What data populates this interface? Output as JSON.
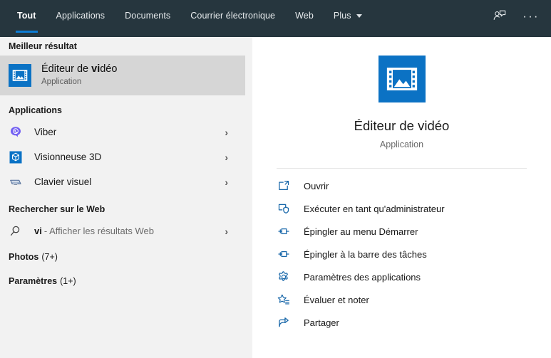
{
  "header": {
    "tabs": [
      {
        "label": "Tout",
        "active": true
      },
      {
        "label": "Applications",
        "active": false
      },
      {
        "label": "Documents",
        "active": false
      },
      {
        "label": "Courrier électronique",
        "active": false
      },
      {
        "label": "Web",
        "active": false
      },
      {
        "label": "Plus",
        "active": false,
        "has_caret": true
      }
    ],
    "feedback_icon": "person-feedback-icon",
    "overflow_label": "···",
    "background_color": "#26363e",
    "accent_color": "#0c7cd5"
  },
  "sidebar": {
    "best_match": {
      "section_label": "Meilleur résultat",
      "title_prefix": "Éditeur de ",
      "title_match": "vi",
      "title_suffix": "déo",
      "subtitle": "Application",
      "icon": "video-editor-icon",
      "highlight_color": "#d6d6d6"
    },
    "apps": {
      "section_label": "Applications",
      "items": [
        {
          "label": "Viber",
          "icon": "viber-icon",
          "chevron": "›"
        },
        {
          "label": "Visionneuse 3D",
          "icon": "3d-viewer-icon",
          "chevron": "›"
        },
        {
          "label": "Clavier visuel",
          "icon": "on-screen-keyboard-icon",
          "chevron": "›"
        }
      ]
    },
    "web": {
      "section_label": "Rechercher sur le Web",
      "query": "vi",
      "suffix": "- Afficher les résultats Web",
      "icon": "search-icon",
      "chevron": "›"
    },
    "counts": [
      {
        "label": "Photos",
        "count": "(7+)"
      },
      {
        "label": "Paramètres",
        "count": "(1+)"
      }
    ]
  },
  "main": {
    "app_icon": "video-editor-icon",
    "title": "Éditeur de vidéo",
    "subtitle": "Application",
    "actions": [
      {
        "label": "Ouvrir",
        "icon": "open-icon"
      },
      {
        "label": "Exécuter en tant qu'administrateur",
        "icon": "run-as-admin-icon"
      },
      {
        "label": "Épingler au menu Démarrer",
        "icon": "pin-start-icon"
      },
      {
        "label": "Épingler à la barre des tâches",
        "icon": "pin-taskbar-icon"
      },
      {
        "label": "Paramètres des applications",
        "icon": "gear-icon"
      },
      {
        "label": "Évaluer et noter",
        "icon": "rate-review-icon"
      },
      {
        "label": "Partager",
        "icon": "share-icon"
      }
    ]
  }
}
